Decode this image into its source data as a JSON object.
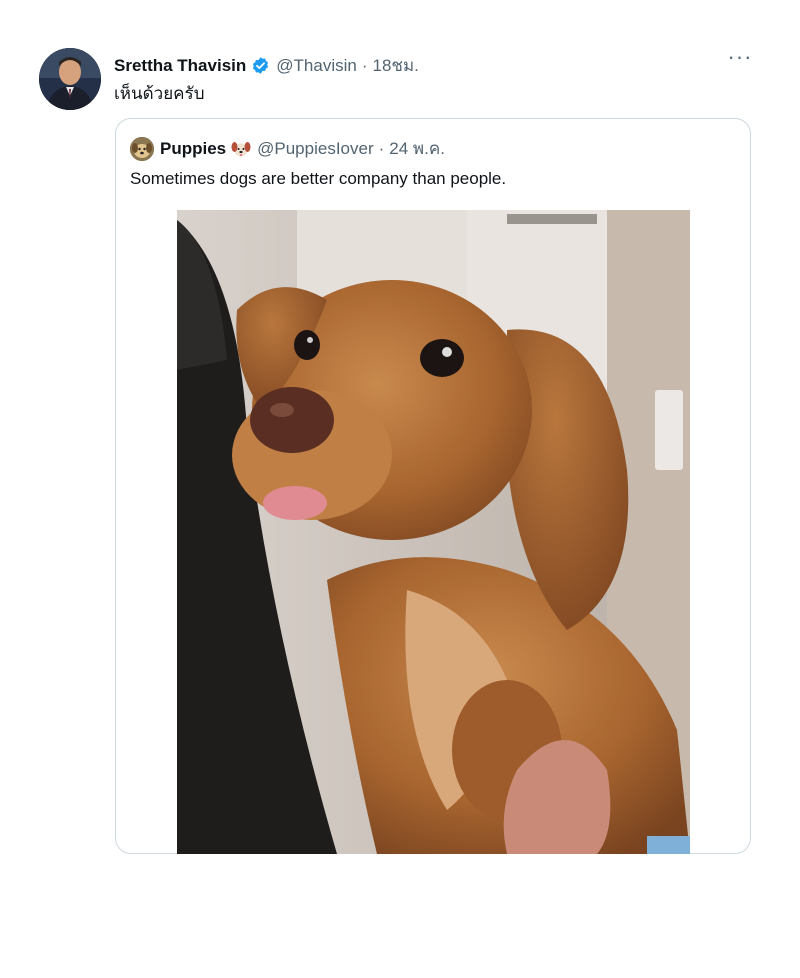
{
  "tweet": {
    "author_name": "Srettha Thavisin",
    "handle": "@Thavisin",
    "separator": "·",
    "time": "18ชม.",
    "text": "เห็นด้วยครับ",
    "more_label": "···",
    "avatar_icon": "profile-photo",
    "verified_icon": "verified-badge-icon",
    "colors": {
      "verified": "#1d9bf0",
      "secondary_text": "#536471",
      "border": "#cfd9de"
    }
  },
  "quote": {
    "author_name": "Puppies",
    "handle": "@PuppiesIover",
    "separator": "·",
    "time": "24 พ.ค.",
    "text": "Sometimes dogs are better company than people.",
    "emoji_icon": "dog-face-icon",
    "media_description_icon": "puppy-photo"
  }
}
